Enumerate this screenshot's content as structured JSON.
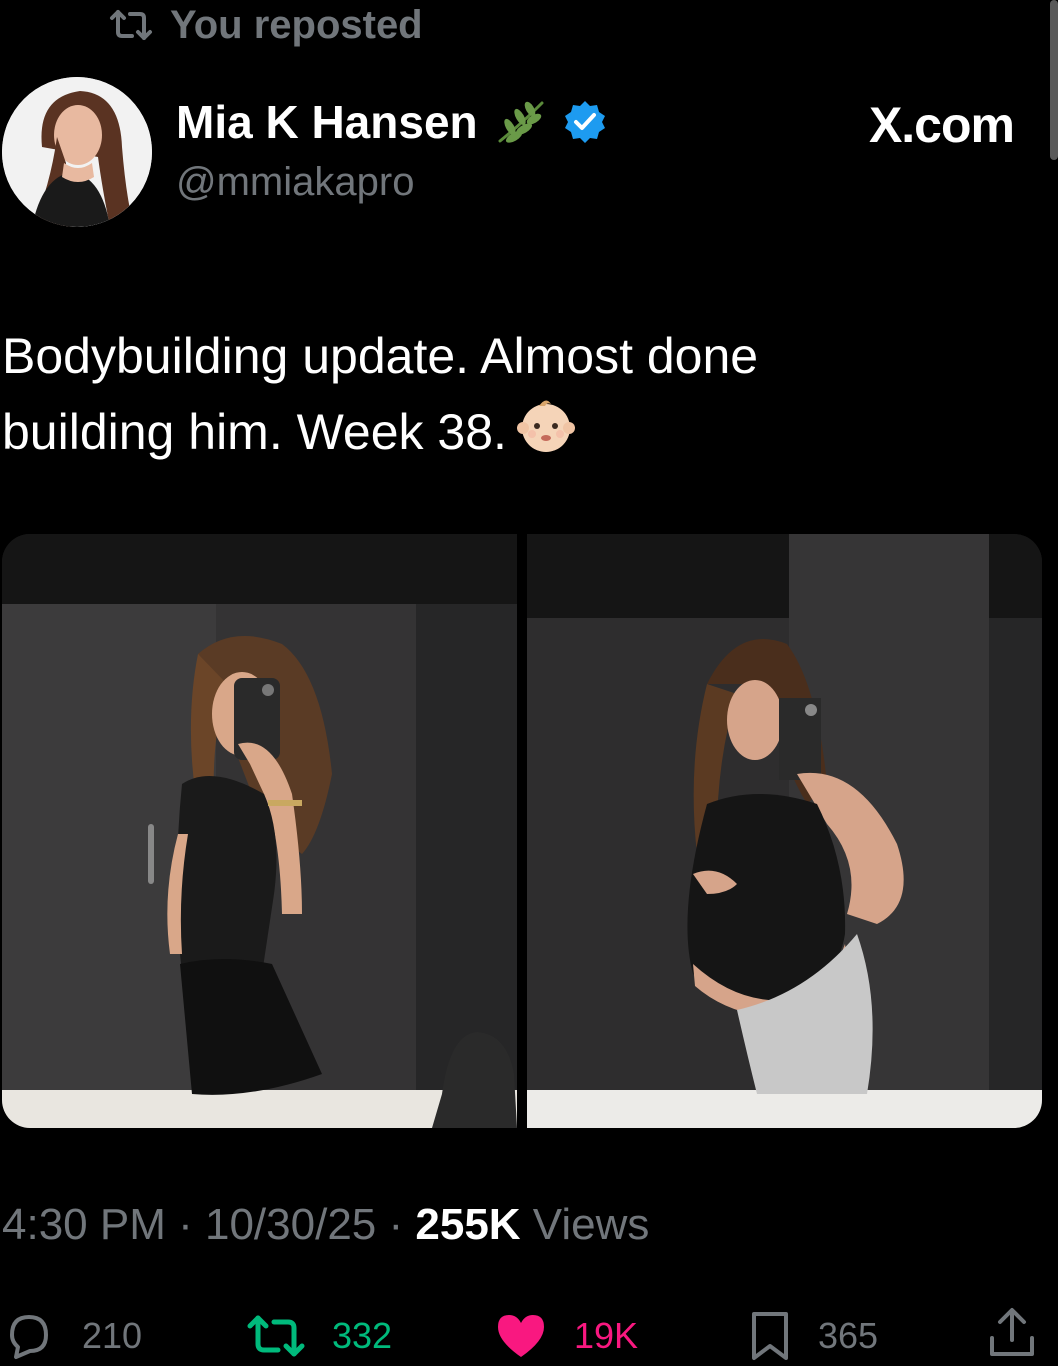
{
  "repost": {
    "label": "You reposted"
  },
  "author": {
    "name": "Mia K Hansen",
    "handle": "@mmiakapro",
    "verified": true,
    "badge_icon": "leaf-icon"
  },
  "brand": {
    "label": "X.com"
  },
  "tweet": {
    "line1": "Bodybuilding update. Almost done",
    "line2": "building him. Week 38.",
    "emoji": "baby-face-icon"
  },
  "media": {
    "count": 2,
    "items": [
      {
        "icon": "photo-before"
      },
      {
        "icon": "photo-week-38"
      }
    ]
  },
  "meta": {
    "time": "4:30 PM",
    "sep1": " · ",
    "date": "10/30/25",
    "sep2": " · ",
    "views_count": "255K",
    "views_label": " Views"
  },
  "actions": {
    "replies": "210",
    "reposts": "332",
    "likes": "19K",
    "bookmarks": "365"
  },
  "colors": {
    "background": "#000000",
    "secondary_text": "#71767b",
    "verified": "#1d9bf0",
    "repost_active": "#00ba7c",
    "like_active": "#f91880"
  }
}
